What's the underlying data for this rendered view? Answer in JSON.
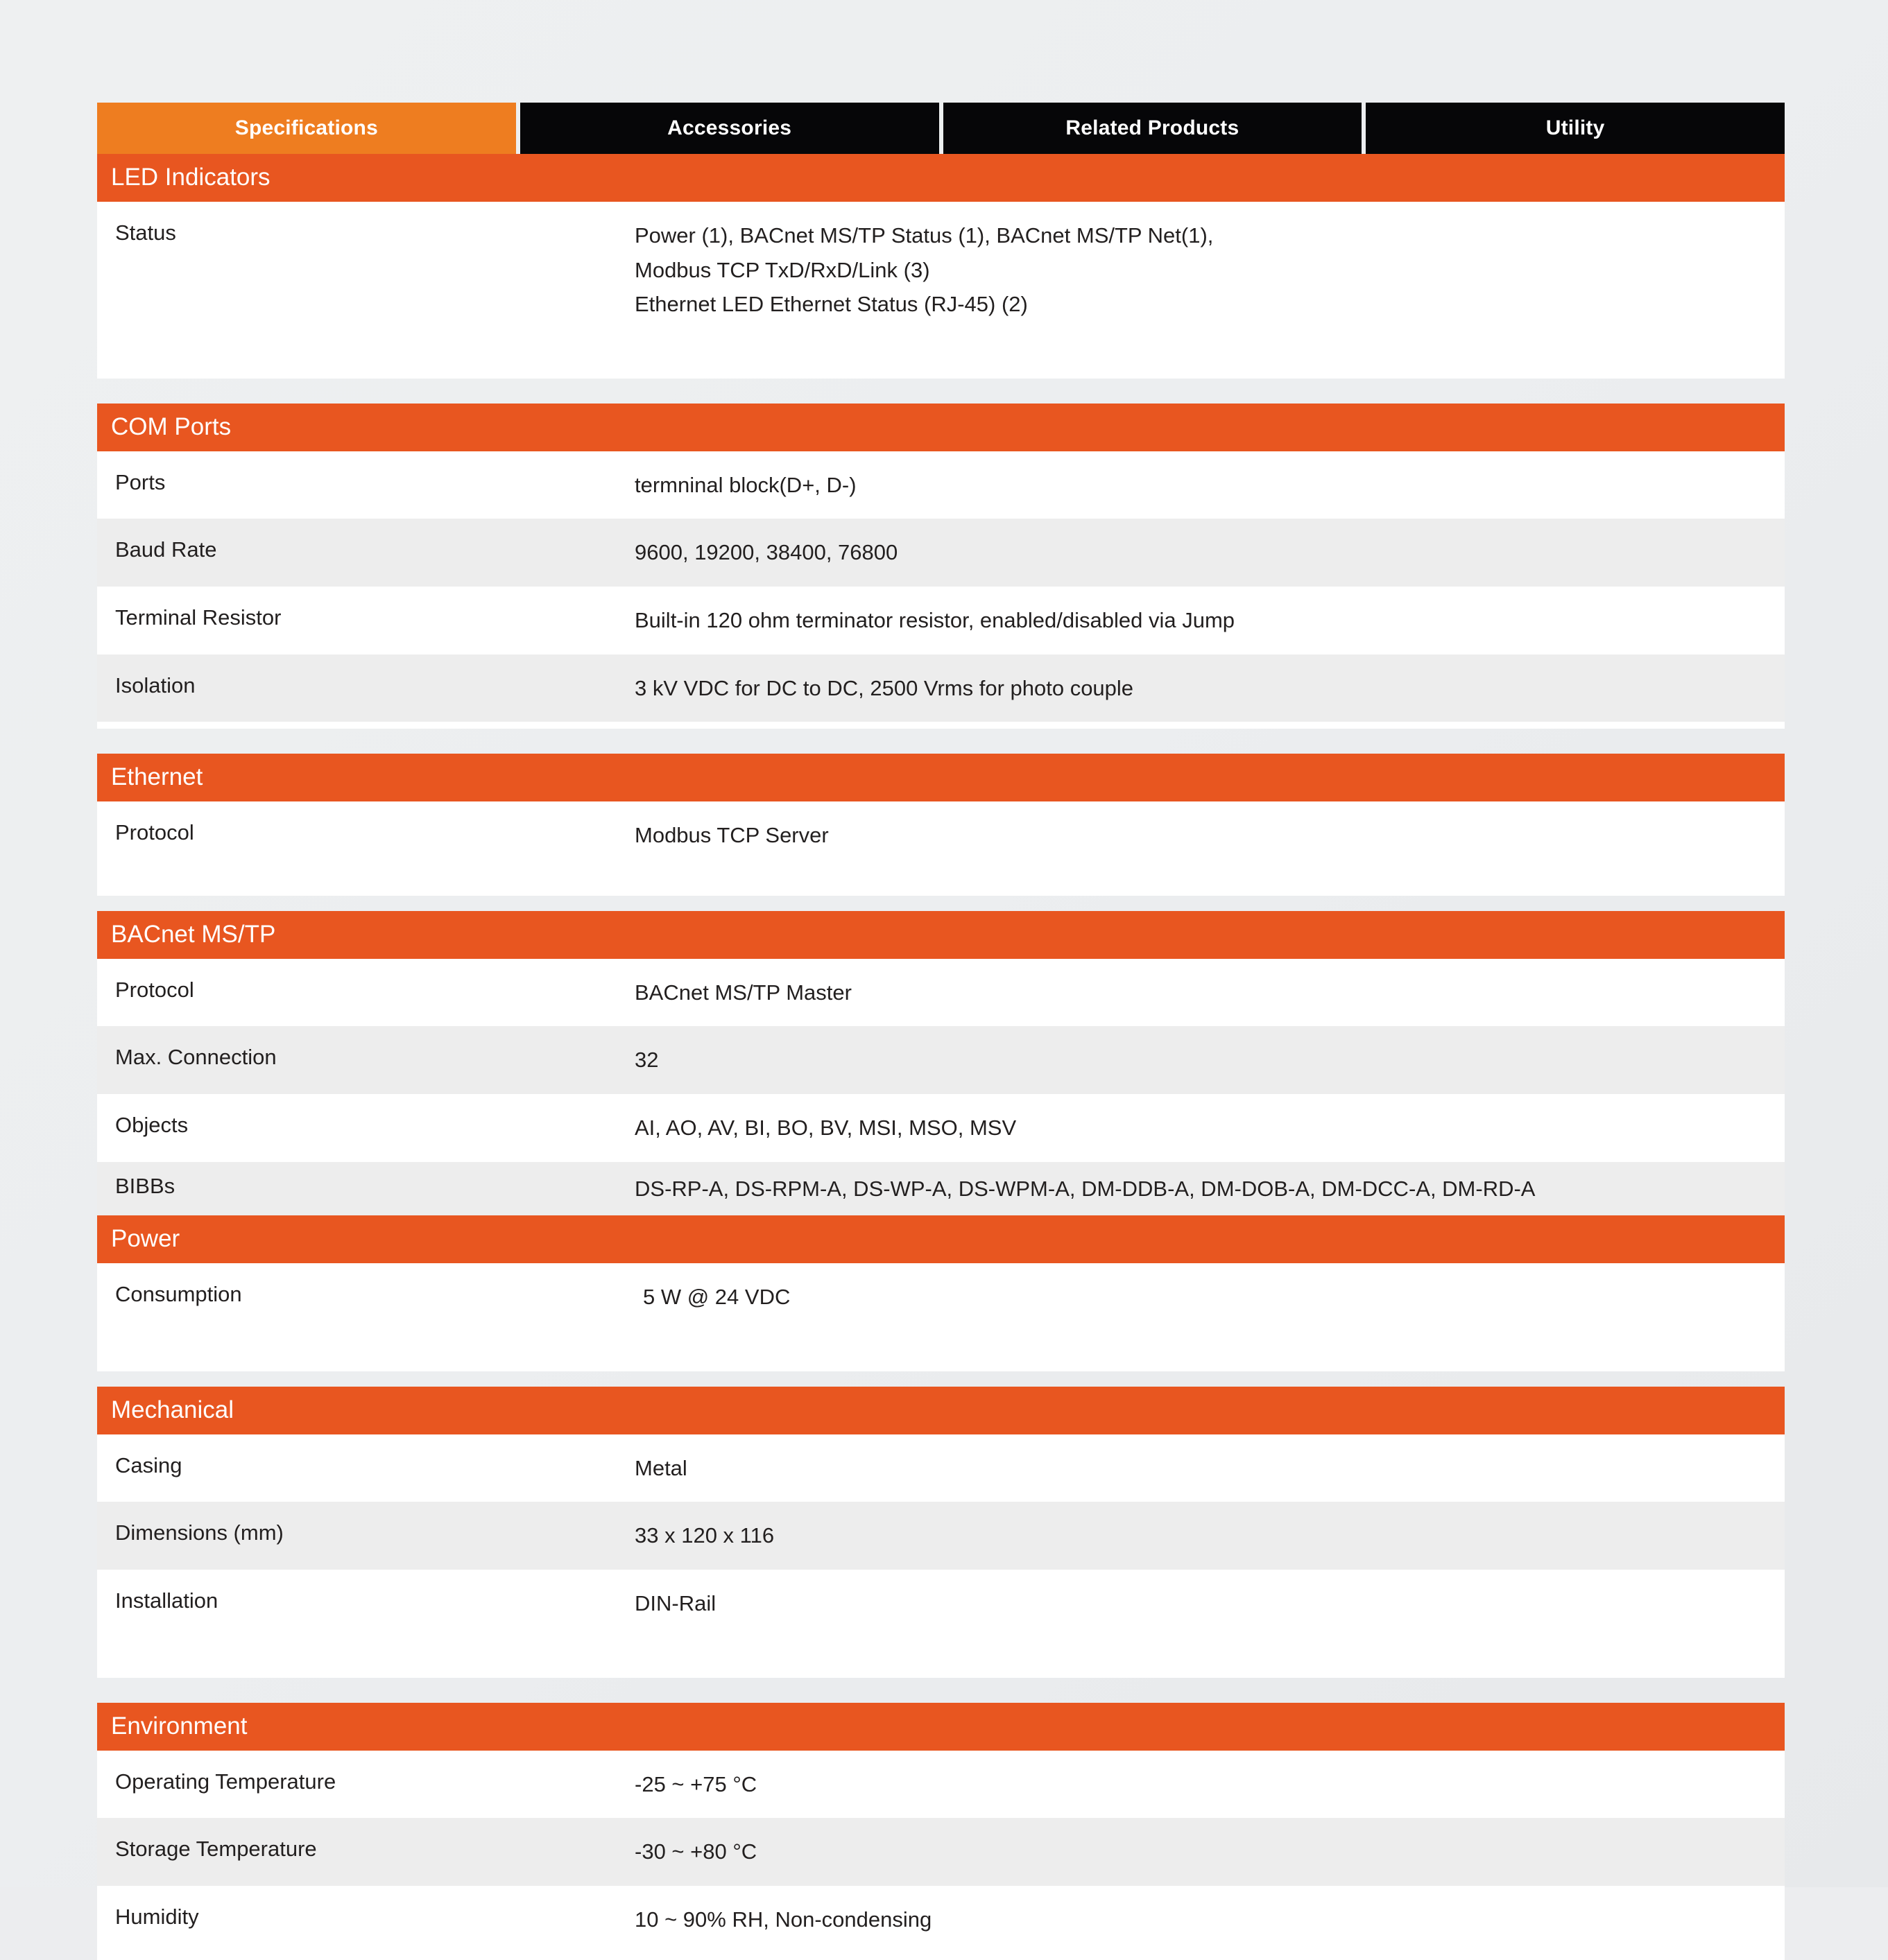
{
  "tabs": [
    {
      "label": "Specifications",
      "active": true
    },
    {
      "label": "Accessories",
      "active": false
    },
    {
      "label": "Related Products",
      "active": false
    },
    {
      "label": "Utility",
      "active": false
    }
  ],
  "colors": {
    "tab_active": "#EE7D20",
    "tab_inactive": "#060608",
    "section_header": "#E85620",
    "row_alt": "#EDEDED",
    "row_base": "#FFFFFF",
    "page_background": "#ECEDEF",
    "text": "#221F1F"
  },
  "sections": [
    {
      "title": "LED Indicators",
      "rows": [
        {
          "label": "Status",
          "value": "Power (1), BACnet MS/TP Status (1), BACnet MS/TP Net(1),\nModbus TCP TxD/RxD/Link (3)\nEthernet LED Ethernet Status (RJ-45) (2)"
        }
      ]
    },
    {
      "title": "COM Ports",
      "rows": [
        {
          "label": "Ports",
          "value": "termninal block(D+, D-)"
        },
        {
          "label": "Baud Rate",
          "value": "9600, 19200, 38400, 76800"
        },
        {
          "label": "Terminal Resistor",
          "value": "Built-in 120 ohm terminator resistor, enabled/disabled via Jump"
        },
        {
          "label": "Isolation",
          "value": "3 kV VDC for DC to DC, 2500 Vrms for photo couple"
        }
      ]
    },
    {
      "title": "Ethernet",
      "rows": [
        {
          "label": "Protocol",
          "value": "Modbus TCP Server"
        }
      ]
    },
    {
      "title": "BACnet MS/TP",
      "rows": [
        {
          "label": "Protocol",
          "value": "BACnet MS/TP Master"
        },
        {
          "label": "Max. Connection",
          "value": "32"
        },
        {
          "label": "Objects",
          "value": "AI, AO, AV, BI, BO, BV, MSI, MSO, MSV"
        },
        {
          "label": "BIBBs",
          "value": "DS-RP-A, DS-RPM-A, DS-WP-A, DS-WPM-A, DM-DDB-A, DM-DOB-A, DM-DCC-A, DM-RD-A"
        }
      ]
    },
    {
      "title": "Power",
      "rows": [
        {
          "label": "Consumption",
          "value": "5 W @ 24 VDC"
        }
      ]
    },
    {
      "title": "Mechanical",
      "rows": [
        {
          "label": "Casing",
          "value": "Metal"
        },
        {
          "label": "Dimensions (mm)",
          "value": "33 x 120 x 116"
        },
        {
          "label": "Installation",
          "value": "DIN-Rail"
        }
      ]
    },
    {
      "title": "Environment",
      "rows": [
        {
          "label": "Operating Temperature",
          "value": "-25 ~ +75 °C"
        },
        {
          "label": "Storage Temperature",
          "value": "-30 ~ +80 °C"
        },
        {
          "label": "Humidity",
          "value": "10 ~ 90% RH, Non-condensing"
        }
      ]
    }
  ]
}
